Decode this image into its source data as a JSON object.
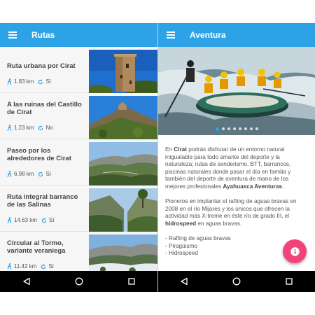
{
  "left_screen": {
    "appbar": {
      "title": "Rutas",
      "menu_icon": "menu-icon"
    },
    "routes": [
      {
        "title": "Ruta urbana por Cirat",
        "distance": "1.83 km",
        "circular": "Sí",
        "image": "tower"
      },
      {
        "title": "A las ruinas del Castillo de Cirat",
        "distance": "1.23 km",
        "circular": "No",
        "image": "castle-hill"
      },
      {
        "title": "Paseo por los alrededores de Cirat",
        "distance": "6.98 km",
        "circular": "Sí",
        "image": "valley"
      },
      {
        "title": "Ruta integral barranco de las Salinas",
        "distance": "14.63 km",
        "circular": "Sí",
        "image": "ravine"
      },
      {
        "title": "Circular al Tormo, variante veraniega",
        "distance": "11.42 km",
        "circular": "Sí",
        "image": "snow-valley"
      }
    ],
    "icons": {
      "distance": "walking-icon",
      "circular": "loop-icon"
    }
  },
  "right_screen": {
    "appbar": {
      "title": "Aventura",
      "menu_icon": "menu-icon"
    },
    "hero": {
      "image": "rafting",
      "pages": 8,
      "active_page": 1
    },
    "article": {
      "p1_a": "En ",
      "p1_b": "Cirat",
      "p1_c": " podrás disfrutar de un entorno natural inigualable para todo amante del deporte y la naturaleza; rutas de senderismo, BTT, barrancos, piscinas naturales donde pasar el día en familia y también del deporte de aventura de mano de los mejores profesionales ",
      "p1_d": "Ayahuasca Aventuras",
      "p1_e": ".",
      "p2_a": "Pioneros en implantar el rafting de aguas bravas en 2008 en el río Mijares y los únicos que ofrecen la actividad más X-treme en éste río de grado III, el ",
      "p2_b": "hidrospeed",
      "p2_c": " en aguas bravas.",
      "list": [
        "- Rafting de aguas bravas",
        "- Piragüismo",
        "- Hidrospeed"
      ]
    },
    "fab_icon": "info-icon"
  },
  "navbar": {
    "back_icon": "back-icon",
    "home_icon": "home-icon",
    "recents_icon": "recents-icon"
  },
  "colors": {
    "primary": "#2ea2e6",
    "accent": "#f4437a",
    "navbar": "#000000",
    "text": "#555555"
  }
}
